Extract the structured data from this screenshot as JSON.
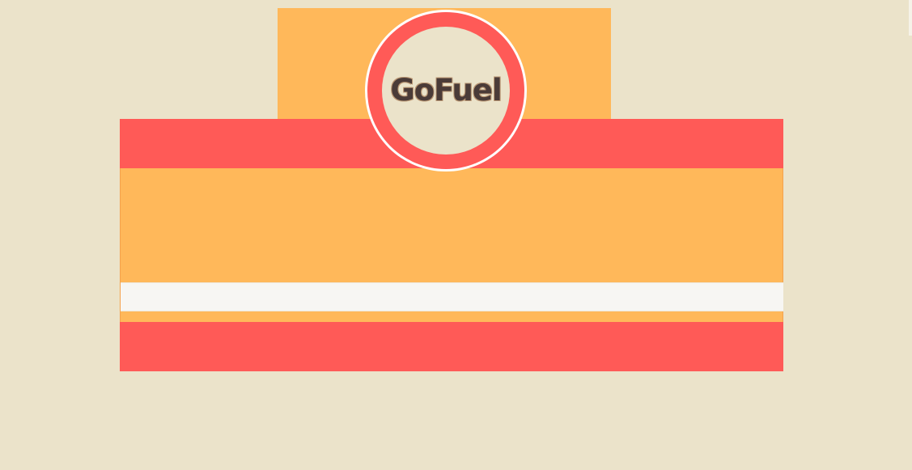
{
  "app": {
    "logo_text": "GoFuel"
  },
  "colors": {
    "page_background": "#EBE3CA",
    "accent_orange": "#FFB85A",
    "accent_red": "#FF5A57",
    "logo_text": "#4A3B38",
    "strip_white": "#F7F6F3"
  },
  "icons": {
    "logo": "gofuel-logo-icon"
  }
}
